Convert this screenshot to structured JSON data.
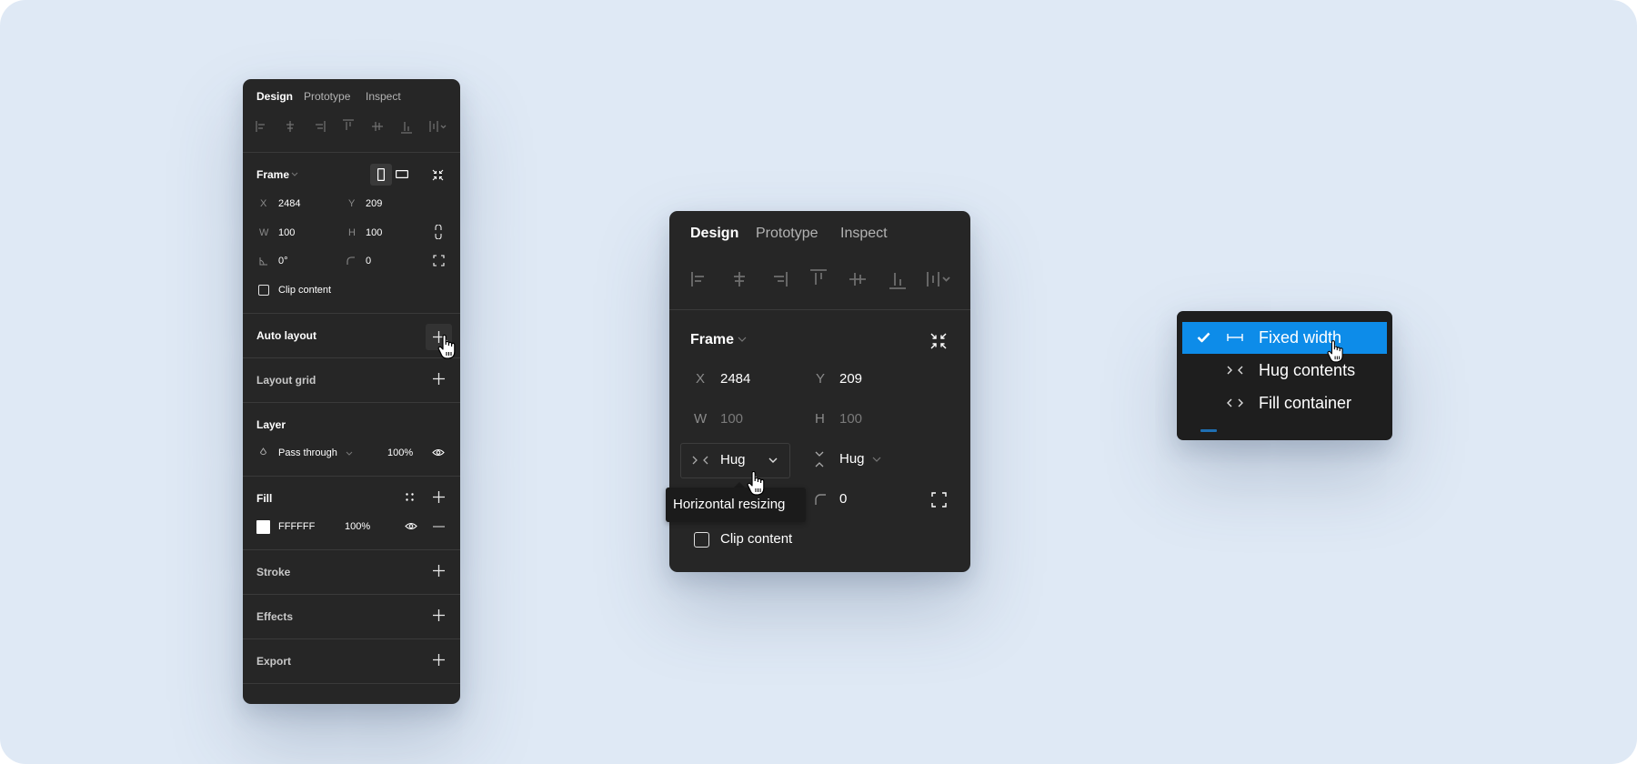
{
  "tabs": [
    "Design",
    "Prototype",
    "Inspect"
  ],
  "left_panel": {
    "frame": {
      "title": "Frame",
      "x_label": "X",
      "x_value": "2484",
      "y_label": "Y",
      "y_value": "209",
      "w_label": "W",
      "w_value": "100",
      "h_label": "H",
      "h_value": "100",
      "rotation_value": "0°",
      "radius_value": "0",
      "clip_content_label": "Clip content",
      "clip_content_checked": false
    },
    "sections": {
      "auto_layout": "Auto layout",
      "layout_grid": "Layout grid",
      "layer": "Layer",
      "fill": "Fill",
      "stroke": "Stroke",
      "effects": "Effects",
      "export": "Export"
    },
    "layer": {
      "blend_mode": "Pass through",
      "opacity": "100%"
    },
    "fill": {
      "color_hex": "FFFFFF",
      "opacity": "100%",
      "swatch_color": "#FFFFFF"
    }
  },
  "middle_panel": {
    "frame_title": "Frame",
    "x_label": "X",
    "x_value": "2484",
    "y_label": "Y",
    "y_value": "209",
    "w_label": "W",
    "w_value": "100",
    "h_label": "H",
    "h_value": "100",
    "horizontal_resizing_value": "Hug",
    "vertical_resizing_value": "Hug",
    "radius_value": "0",
    "clip_content_label": "Clip content",
    "tooltip": "Horizontal resizing"
  },
  "resizing_menu": {
    "items": [
      {
        "label": "Fixed width",
        "icon": "fixed-width-icon",
        "selected": true
      },
      {
        "label": "Hug contents",
        "icon": "hug-contents-icon",
        "selected": false
      },
      {
        "label": "Fill container",
        "icon": "fill-container-icon",
        "selected": false
      }
    ]
  },
  "colors": {
    "canvas_bg": "#DFE9F5",
    "panel_bg": "#262626",
    "menu_bg": "#1E1E1E",
    "accent": "#0D8CE9"
  }
}
